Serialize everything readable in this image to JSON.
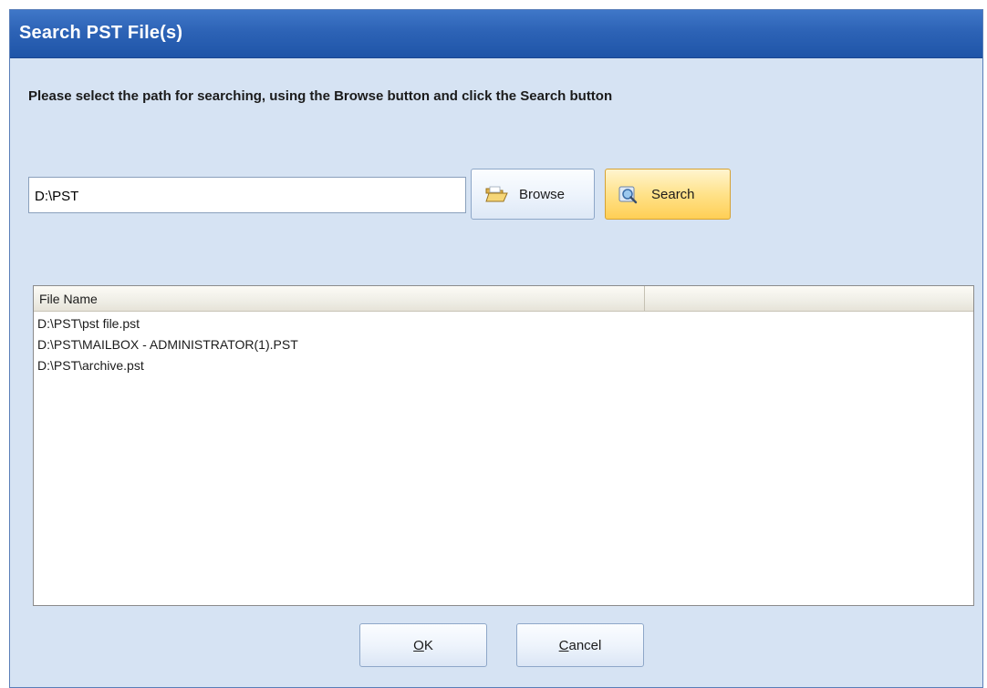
{
  "dialog": {
    "title": "Search PST File(s)",
    "instruction": "Please select the path for searching, using the Browse button and click the Search button"
  },
  "path_input": {
    "value": "D:\\PST"
  },
  "buttons": {
    "browse": {
      "label": "Browse",
      "icon": "open-folder-icon"
    },
    "search": {
      "label": "Search",
      "icon": "magnifier-search-icon"
    },
    "ok": {
      "mnemonic": "O",
      "rest": "K"
    },
    "cancel": {
      "mnemonic": "C",
      "rest": "ancel"
    }
  },
  "file_list": {
    "columns": [
      "File Name",
      ""
    ],
    "rows": [
      "D:\\PST\\pst file.pst",
      "D:\\PST\\MAILBOX - ADMINISTRATOR(1).PST",
      "D:\\PST\\archive.pst"
    ]
  },
  "colors": {
    "title_bar": "#2d63b6",
    "dialog_background": "#d6e3f3",
    "search_button_highlight": "#ffe28a"
  }
}
